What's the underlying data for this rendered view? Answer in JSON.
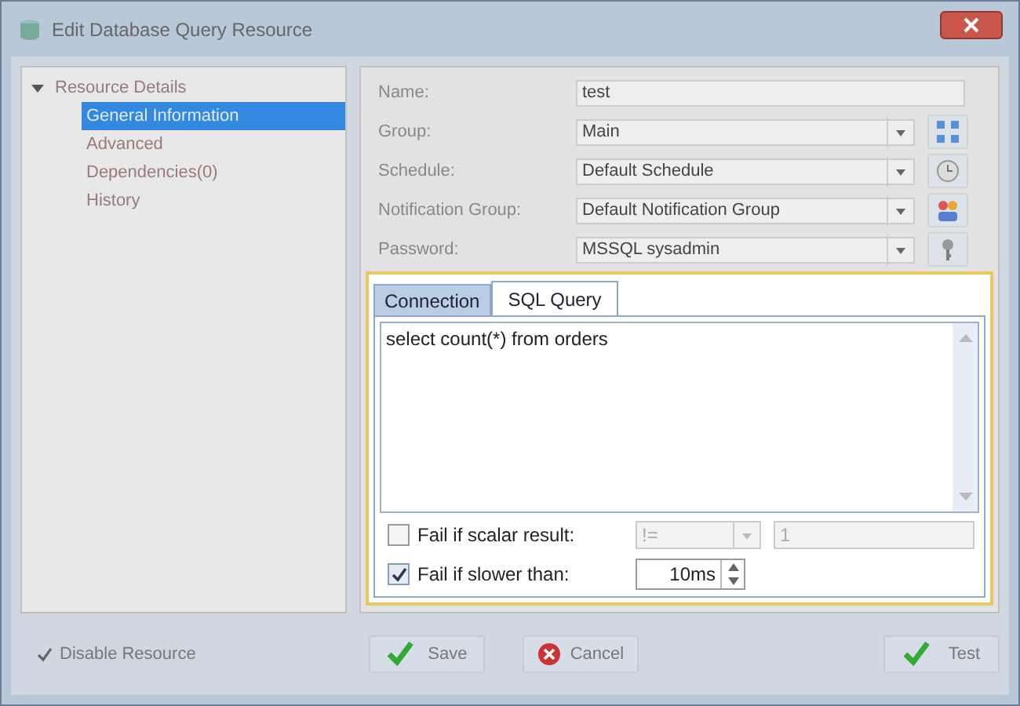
{
  "window": {
    "title": "Edit Database Query Resource"
  },
  "tree": [
    {
      "label": "Resource Details",
      "expanded": true,
      "selected": false,
      "children": [
        {
          "label": "General Information",
          "selected": true
        },
        {
          "label": "Advanced",
          "selected": false
        },
        {
          "label": "Dependencies(0)",
          "selected": false
        },
        {
          "label": "History",
          "selected": false
        }
      ]
    }
  ],
  "form": [
    {
      "label": "Name:",
      "kind": "text",
      "value": "test"
    },
    {
      "label": "Group:",
      "kind": "combo",
      "value": "Main"
    },
    {
      "label": "Schedule:",
      "kind": "combo",
      "value": "Default Schedule"
    },
    {
      "label": "Notification Group:",
      "kind": "combo",
      "value": "Default Notification Group"
    },
    {
      "label": "Password:",
      "kind": "combo",
      "value": "MSSQL sysadmin"
    }
  ],
  "tabs": [
    {
      "label": "Connection",
      "selected": false
    },
    {
      "label": "SQL Query",
      "selected": true
    }
  ],
  "query": "select count(*) from orders",
  "options": [
    {
      "label": "Fail if scalar result:",
      "checked": false,
      "kind": "scalar",
      "operator": "!=",
      "value": "1"
    },
    {
      "label": "Fail if slower than:",
      "checked": true,
      "kind": "duration",
      "value": "10ms"
    }
  ],
  "disable_resource": {
    "label": "Disable Resource",
    "checked": true
  },
  "buttons": [
    {
      "label": "Save"
    },
    {
      "label": "Cancel"
    },
    {
      "label": "Test"
    }
  ]
}
